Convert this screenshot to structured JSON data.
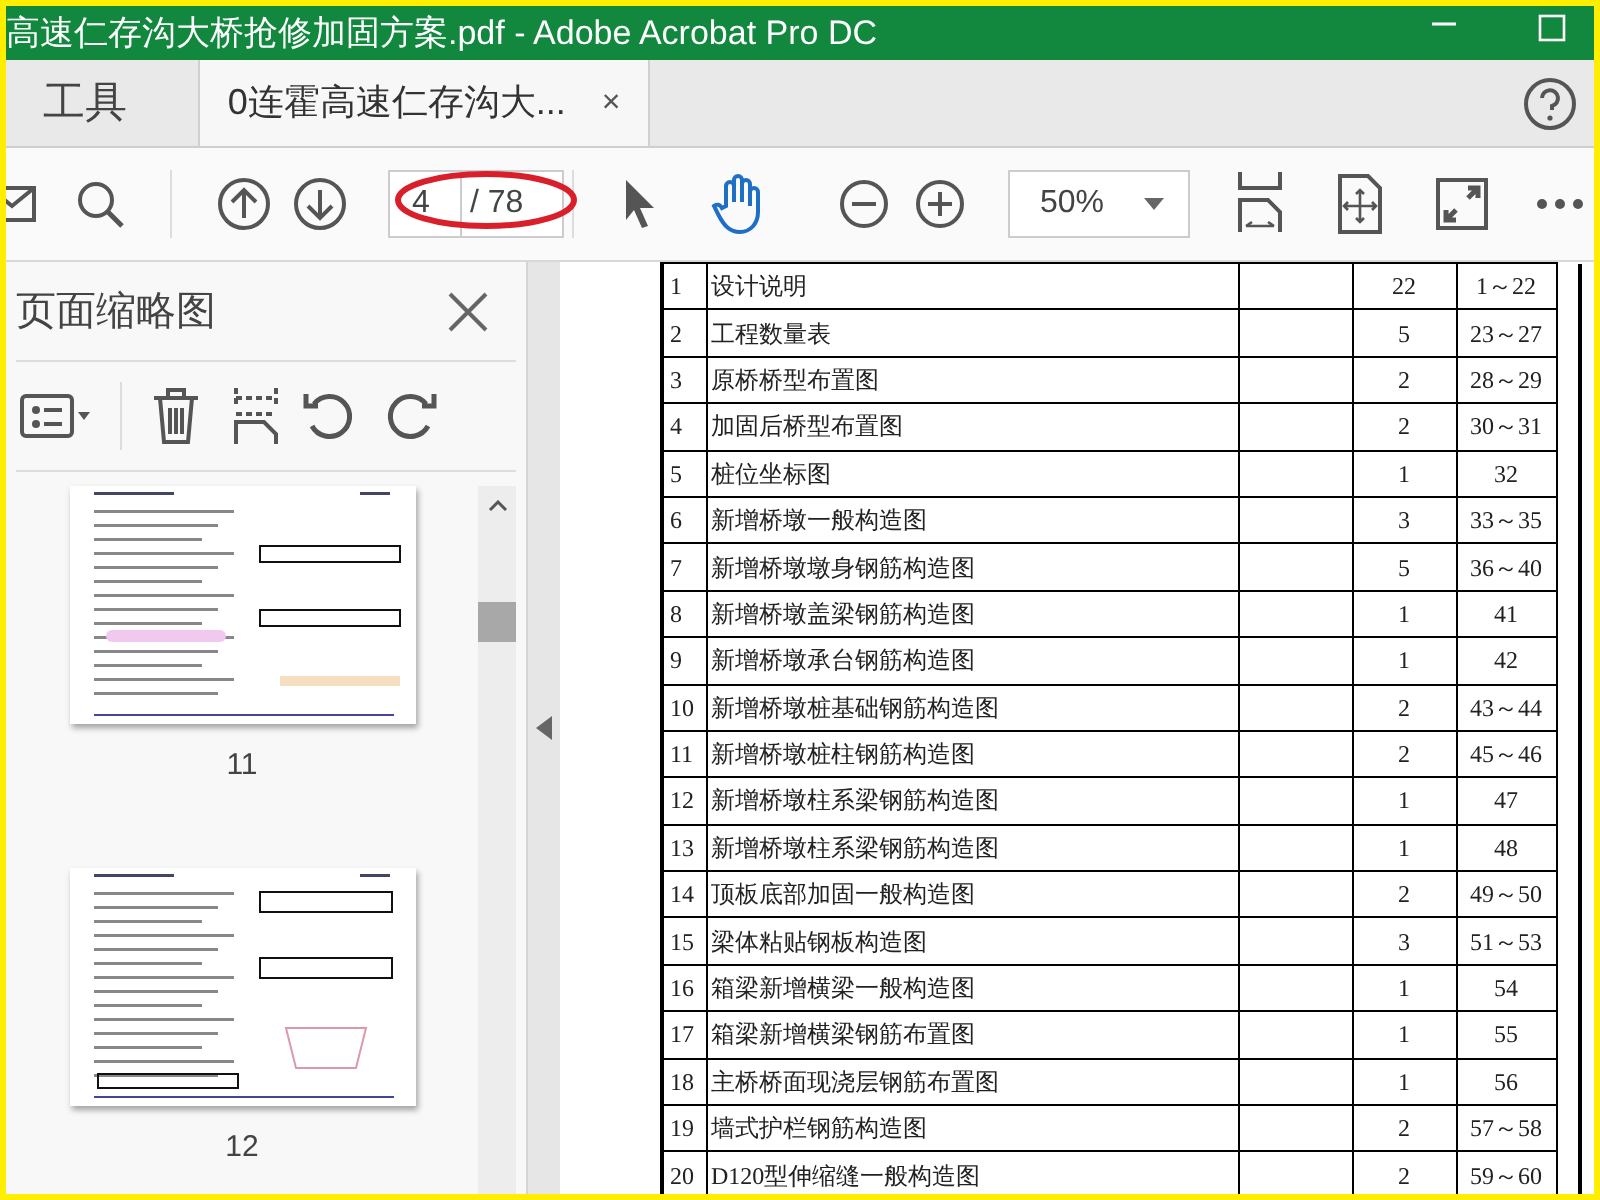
{
  "window": {
    "title": "高速仁存沟大桥抢修加固方案.pdf - Adobe Acrobat Pro DC"
  },
  "tabs": [
    {
      "label": "工具",
      "selected": false
    },
    {
      "label": "0连霍高速仁存沟大...",
      "selected": true,
      "close": "×"
    }
  ],
  "toolbar": {
    "page_number": "4",
    "page_total": "/ 78",
    "zoom": "50%"
  },
  "thumbnail_pane": {
    "title": "页面缩略图",
    "pages": [
      {
        "label": "11"
      },
      {
        "label": "12"
      }
    ]
  },
  "table": {
    "rows": [
      [
        "1",
        "设计说明",
        "",
        "22",
        "1～22"
      ],
      [
        "2",
        "工程数量表",
        "",
        "5",
        "23～27"
      ],
      [
        "3",
        "原桥桥型布置图",
        "",
        "2",
        "28～29"
      ],
      [
        "4",
        "加固后桥型布置图",
        "",
        "2",
        "30～31"
      ],
      [
        "5",
        "桩位坐标图",
        "",
        "1",
        "32"
      ],
      [
        "6",
        "新增桥墩一般构造图",
        "",
        "3",
        "33～35"
      ],
      [
        "7",
        "新增桥墩墩身钢筋构造图",
        "",
        "5",
        "36～40"
      ],
      [
        "8",
        "新增桥墩盖梁钢筋构造图",
        "",
        "1",
        "41"
      ],
      [
        "9",
        "新增桥墩承台钢筋构造图",
        "",
        "1",
        "42"
      ],
      [
        "10",
        "新增桥墩桩基础钢筋构造图",
        "",
        "2",
        "43～44"
      ],
      [
        "11",
        "新增桥墩桩柱钢筋构造图",
        "",
        "2",
        "45～46"
      ],
      [
        "12",
        "新增桥墩柱系梁钢筋构造图",
        "",
        "1",
        "47"
      ],
      [
        "13",
        "新增桥墩柱系梁钢筋构造图",
        "",
        "1",
        "48"
      ],
      [
        "14",
        "顶板底部加固一般构造图",
        "",
        "2",
        "49～50"
      ],
      [
        "15",
        "梁体粘贴钢板构造图",
        "",
        "3",
        "51～53"
      ],
      [
        "16",
        "箱梁新增横梁一般构造图",
        "",
        "1",
        "54"
      ],
      [
        "17",
        "箱梁新增横梁钢筋布置图",
        "",
        "1",
        "55"
      ],
      [
        "18",
        "主桥桥面现浇层钢筋布置图",
        "",
        "1",
        "56"
      ],
      [
        "19",
        "墙式护栏钢筋构造图",
        "",
        "2",
        "57～58"
      ],
      [
        "20",
        "D120型伸缩缝一般构造图",
        "",
        "2",
        "59～60"
      ]
    ]
  }
}
